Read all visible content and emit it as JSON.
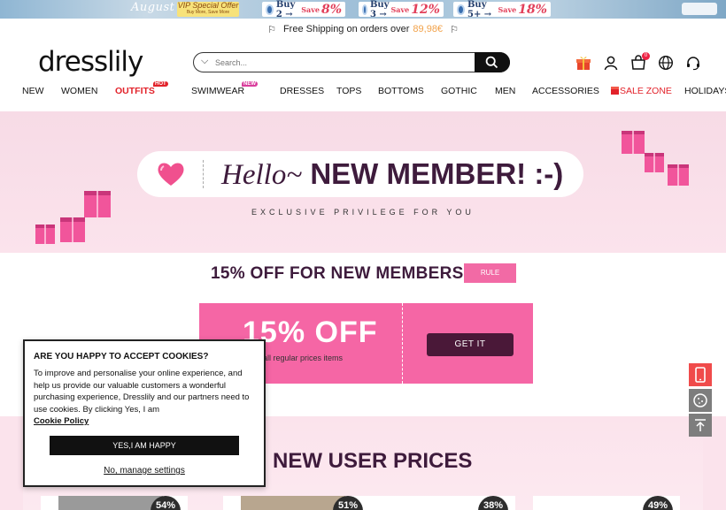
{
  "promo": {
    "august": "August",
    "vip_line1": "VIP Special Offer",
    "vip_line2": "Buy More, Save More",
    "deals": [
      {
        "buy": "Buy 2 → ",
        "save": "Save",
        "pct": "8%"
      },
      {
        "buy": "Buy 3 → ",
        "save": "Save",
        "pct": "12%"
      },
      {
        "buy": "Buy 5+ → ",
        "save": "Save",
        "pct": "18%"
      }
    ]
  },
  "shipping": {
    "text": "Free Shipping on orders over",
    "amount": "89,98€"
  },
  "header": {
    "logo": "dresslily",
    "search_placeholder": "Search...",
    "cart_count": "0"
  },
  "nav": {
    "items": [
      "NEW",
      "WOMEN",
      "OUTFITS",
      "SWIMWEAR",
      "DRESSES",
      "TOPS",
      "BOTTOMS",
      "GOTHIC",
      "MEN",
      "ACCESSORIES",
      "SALE ZONE",
      "HOLIDAYS"
    ],
    "hot_tag": "HOT",
    "new_tag": "NEW"
  },
  "banner": {
    "hello": "Hello~",
    "headline": "NEW MEMBER! :-)",
    "subtitle": "EXCLUSIVE PRIVILEGE FOR YOU"
  },
  "members": {
    "title": "15% OFF FOR NEW MEMBERS",
    "rule": "RULE",
    "coupon_off": "15% OFF",
    "coupon_desc": "all regular prices items",
    "get_it": "GET IT"
  },
  "prices": {
    "title": "NEW USER PRICES",
    "discounts": [
      "54%",
      "51%",
      "38%",
      "49%"
    ]
  },
  "cookie": {
    "heading": "ARE YOU HAPPY TO ACCEPT COOKIES?",
    "body": "To improve and personalise your online experience, and help us provide our valuable customers a wonderful purchasing experience, Dresslily and our partners need to use cookies. By clicking Yes, I am",
    "policy": "Cookie Policy",
    "yes": "YES,I AM HAPPY",
    "manage": "No, manage settings"
  },
  "colors": {
    "accent_pink": "#f566a5",
    "dark_plum": "#3e1b3c",
    "sale_red": "#e2222a"
  }
}
